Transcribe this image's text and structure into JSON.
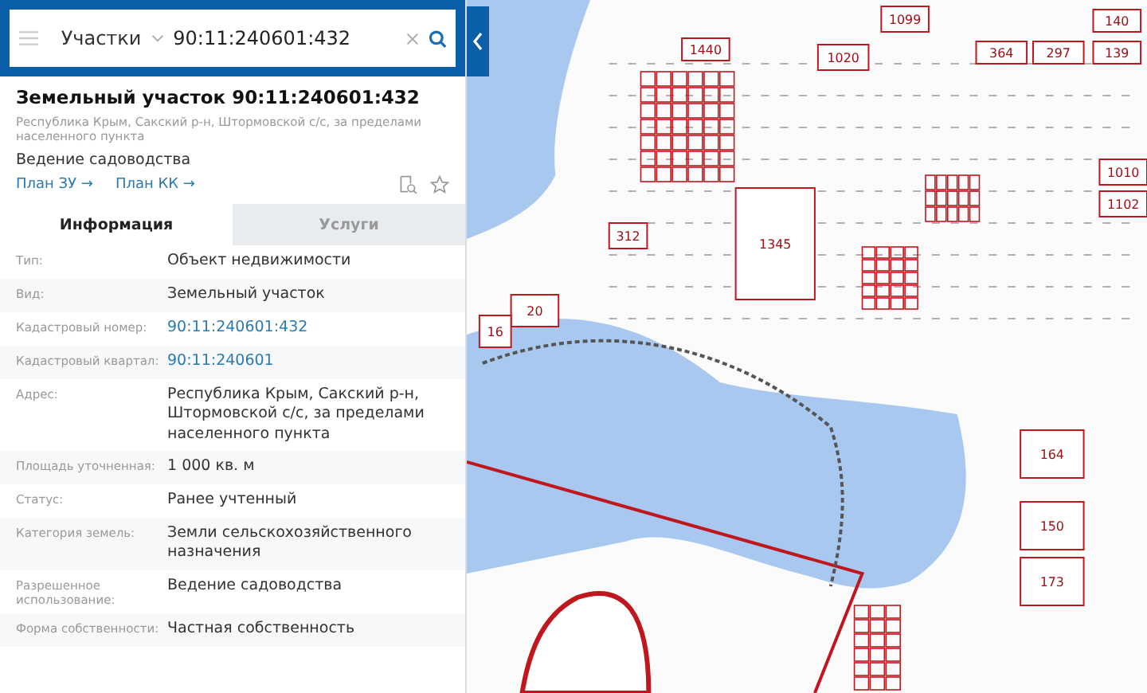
{
  "search": {
    "category": "Участки",
    "value": "90:11:240601:432"
  },
  "object": {
    "title": "Земельный участок 90:11:240601:432",
    "address": "Республика Крым, Сакский р-н, Штормовской с/с, за пределами населенного пункта",
    "usage": "Ведение садоводства",
    "links": [
      "План ЗУ →",
      "План КК →"
    ]
  },
  "tabs": [
    {
      "label": "Информация",
      "selected": true
    },
    {
      "label": "Услуги",
      "selected": false
    }
  ],
  "rows": [
    {
      "label": "Тип:",
      "value": "Объект недвижимости",
      "kind": "text"
    },
    {
      "label": "Вид:",
      "value": "Земельный участок",
      "kind": "text"
    },
    {
      "label": "Кадастровый номер:",
      "value": "90:11:240601:432",
      "kind": "link"
    },
    {
      "label": "Кадастровый квартал:",
      "value": "90:11:240601",
      "kind": "link"
    },
    {
      "label": "Адрес:",
      "value": "Республика Крым, Сакский р-н, Штормовской с/с, за пределами населенного пункта",
      "kind": "text"
    },
    {
      "label": "Площадь уточненная:",
      "value": "1 000 кв. м",
      "kind": "text"
    },
    {
      "label": "Статус:",
      "value": "Ранее учтенный",
      "kind": "text"
    },
    {
      "label": "Категория земель:",
      "value": "Земли сельскохозяйственного назначения",
      "kind": "text"
    },
    {
      "label": "Разрешенное использование:",
      "value": "Ведение садоводства",
      "kind": "text"
    },
    {
      "label": "Форма собственности:",
      "value": "Частная собственность",
      "kind": "text"
    }
  ],
  "map": {
    "parcels": [
      "1440",
      "1345",
      "364",
      "297",
      "140",
      "139",
      "1010",
      "1102",
      "312",
      "20",
      "16",
      "164",
      "150",
      "173",
      "1020",
      "1099"
    ]
  }
}
